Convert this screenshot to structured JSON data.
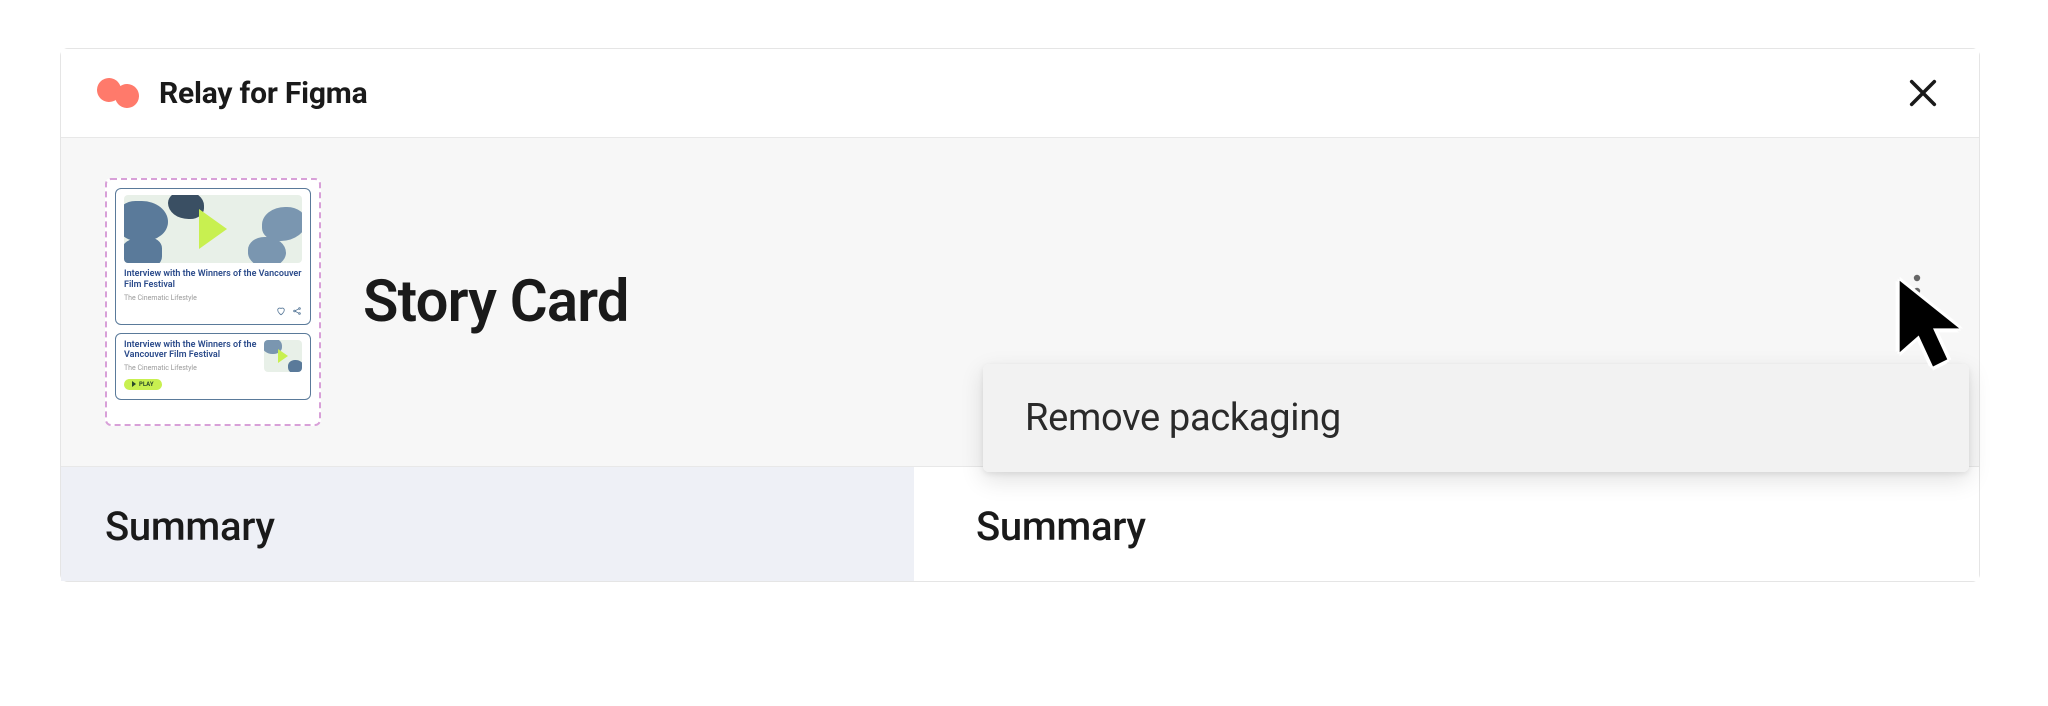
{
  "header": {
    "title": "Relay for Figma"
  },
  "component": {
    "name": "Story Card",
    "thumbnail": {
      "card_title": "Interview with the Winners of the Vancouver Film Festival",
      "card_subtitle": "The Cinematic Lifestyle",
      "play_label": "PLAY"
    }
  },
  "dropdown": {
    "items": [
      {
        "label": "Remove packaging"
      }
    ]
  },
  "tabs": {
    "left": "Summary",
    "right": "Summary"
  }
}
